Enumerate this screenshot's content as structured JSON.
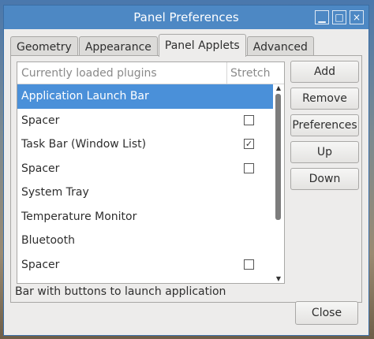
{
  "window": {
    "title": "Panel Preferences",
    "close_glyph": "×",
    "maximize_glyph": "□",
    "minimize_glyph": "▁"
  },
  "tabs": [
    {
      "label": "Geometry",
      "active": false
    },
    {
      "label": "Appearance",
      "active": false
    },
    {
      "label": "Panel Applets",
      "active": true
    },
    {
      "label": "Advanced",
      "active": false
    }
  ],
  "list": {
    "col_name": "Currently loaded plugins",
    "col_stretch": "Stretch",
    "rows": [
      {
        "name": "Application Launch Bar",
        "selected": true,
        "checkbox": false
      },
      {
        "name": "Spacer",
        "selected": false,
        "checkbox": true,
        "checked": false
      },
      {
        "name": "Task Bar (Window List)",
        "selected": false,
        "checkbox": true,
        "checked": true
      },
      {
        "name": "Spacer",
        "selected": false,
        "checkbox": true,
        "checked": false
      },
      {
        "name": "System Tray",
        "selected": false,
        "checkbox": false
      },
      {
        "name": "Temperature Monitor",
        "selected": false,
        "checkbox": false
      },
      {
        "name": "Bluetooth",
        "selected": false,
        "checkbox": false
      },
      {
        "name": "Spacer",
        "selected": false,
        "checkbox": true,
        "checked": false
      }
    ]
  },
  "buttons": {
    "add": "Add",
    "remove": "Remove",
    "preferences": "Preferences",
    "up": "Up",
    "down": "Down",
    "close": "Close"
  },
  "status": "Bar with buttons to launch application",
  "colors": {
    "titlebar": "#4d88c4",
    "selection": "#4a90d9"
  }
}
